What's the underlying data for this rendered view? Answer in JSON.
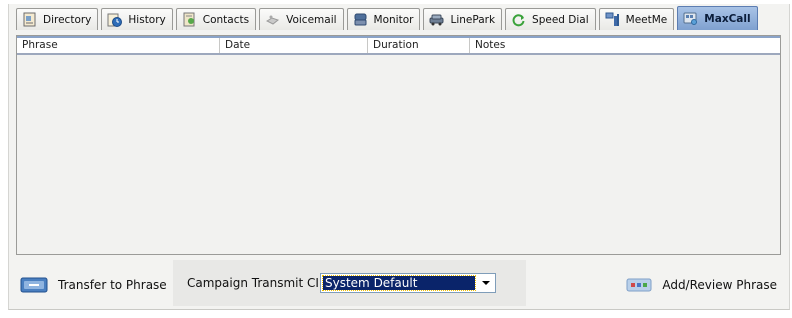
{
  "tabs": [
    {
      "label": "Directory",
      "icon": "directory-icon",
      "active": false
    },
    {
      "label": "History",
      "icon": "history-icon",
      "active": false
    },
    {
      "label": "Contacts",
      "icon": "contacts-icon",
      "active": false
    },
    {
      "label": "Voicemail",
      "icon": "voicemail-icon",
      "active": false
    },
    {
      "label": "Monitor",
      "icon": "monitor-icon",
      "active": false
    },
    {
      "label": "LinePark",
      "icon": "linepark-icon",
      "active": false
    },
    {
      "label": "Speed Dial",
      "icon": "speed-dial-icon",
      "active": false
    },
    {
      "label": "MeetMe",
      "icon": "meetme-icon",
      "active": false
    },
    {
      "label": "MaxCall",
      "icon": "maxcall-icon",
      "active": true
    }
  ],
  "table": {
    "columns": [
      "Phrase",
      "Date",
      "Duration",
      "Notes"
    ],
    "rows": []
  },
  "controls": {
    "transfer_label": "Transfer to Phrase",
    "campaign_label": "Campaign Transmit CID:",
    "campaign_value": "System Default",
    "add_label": "Add/Review Phrase"
  },
  "colors": {
    "active_tab": "#7fa1d0",
    "selection": "#0a246a",
    "panel": "#f2f2f0"
  }
}
